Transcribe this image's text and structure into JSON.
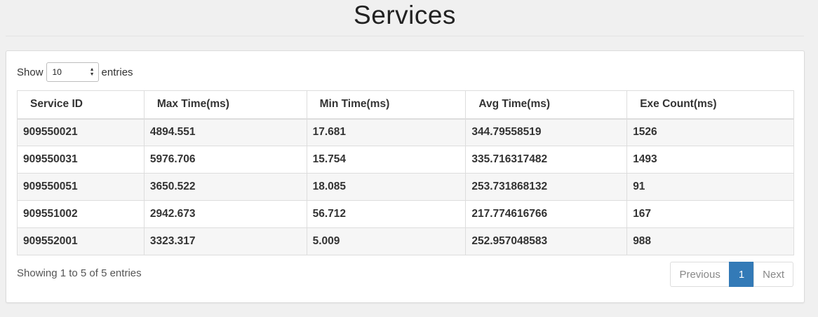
{
  "page": {
    "title": "Services"
  },
  "length_control": {
    "show_label": "Show",
    "selected": "10",
    "entries_label": "entries"
  },
  "table": {
    "columns": [
      "Service ID",
      "Max Time(ms)",
      "Min Time(ms)",
      "Avg Time(ms)",
      "Exe Count(ms)"
    ],
    "rows": [
      [
        "909550021",
        "4894.551",
        "17.681",
        "344.79558519",
        "1526"
      ],
      [
        "909550031",
        "5976.706",
        "15.754",
        "335.716317482",
        "1493"
      ],
      [
        "909550051",
        "3650.522",
        "18.085",
        "253.731868132",
        "91"
      ],
      [
        "909551002",
        "2942.673",
        "56.712",
        "217.774616766",
        "167"
      ],
      [
        "909552001",
        "3323.317",
        "5.009",
        "252.957048583",
        "988"
      ]
    ]
  },
  "footer": {
    "info": "Showing 1 to 5 of 5 entries",
    "pagination": {
      "previous": "Previous",
      "current": "1",
      "next": "Next"
    }
  },
  "colors": {
    "accent": "#337ab7",
    "background": "#f0f0f0"
  },
  "icons": {
    "select_arrows": "up-down-arrows-icon"
  }
}
